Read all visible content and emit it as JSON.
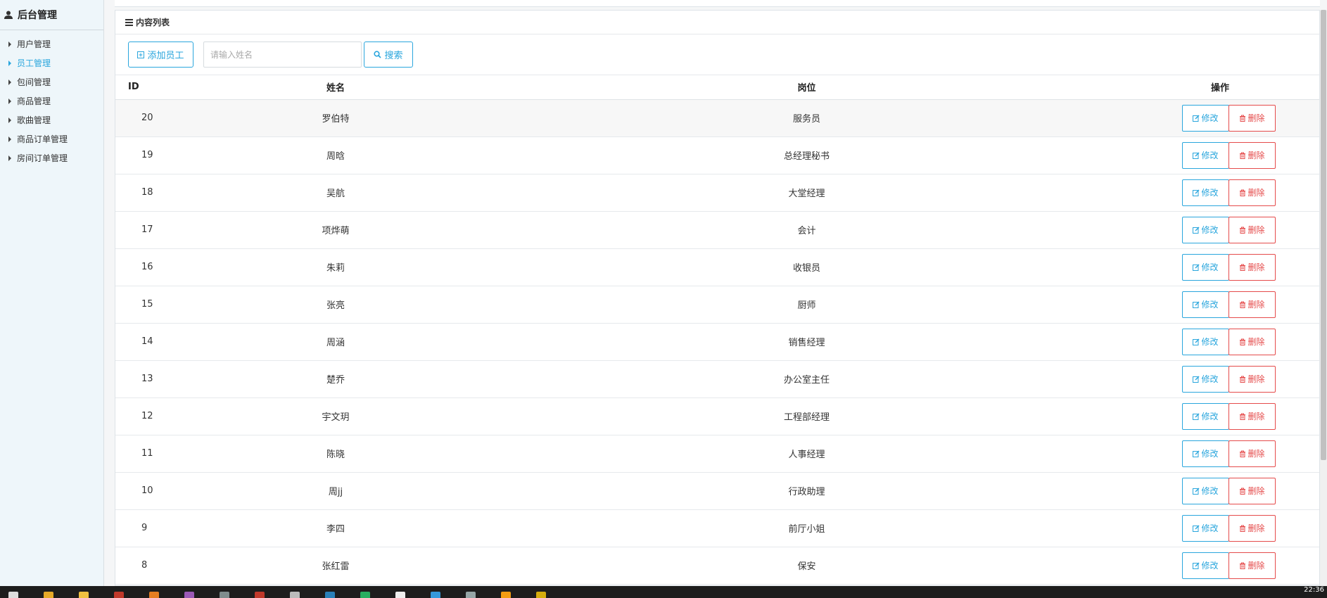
{
  "sidebar": {
    "title": "后台管理",
    "items": [
      {
        "label": "用户管理",
        "active": false
      },
      {
        "label": "员工管理",
        "active": true
      },
      {
        "label": "包间管理",
        "active": false
      },
      {
        "label": "商品管理",
        "active": false
      },
      {
        "label": "歌曲管理",
        "active": false
      },
      {
        "label": "商品订单管理",
        "active": false
      },
      {
        "label": "房间订单管理",
        "active": false
      }
    ]
  },
  "panel": {
    "title": "内容列表"
  },
  "toolbar": {
    "add_label": "添加员工",
    "search_placeholder": "请输入姓名",
    "search_label": "搜索"
  },
  "table": {
    "headers": {
      "id": "ID",
      "name": "姓名",
      "position": "岗位",
      "actions": "操作"
    },
    "edit_label": "修改",
    "delete_label": "删除",
    "rows": [
      {
        "id": "20",
        "name": "罗伯特",
        "position": "服务员"
      },
      {
        "id": "19",
        "name": "周晗",
        "position": "总经理秘书"
      },
      {
        "id": "18",
        "name": "吴航",
        "position": "大堂经理"
      },
      {
        "id": "17",
        "name": "项烨萌",
        "position": "会计"
      },
      {
        "id": "16",
        "name": "朱莉",
        "position": "收银员"
      },
      {
        "id": "15",
        "name": "张亮",
        "position": "厨师"
      },
      {
        "id": "14",
        "name": "周涵",
        "position": "销售经理"
      },
      {
        "id": "13",
        "name": "楚乔",
        "position": "办公室主任"
      },
      {
        "id": "12",
        "name": "宇文玥",
        "position": "工程部经理"
      },
      {
        "id": "11",
        "name": "陈晓",
        "position": "人事经理"
      },
      {
        "id": "10",
        "name": "周jj",
        "position": "行政助理"
      },
      {
        "id": "9",
        "name": "李四",
        "position": "前厅小姐"
      },
      {
        "id": "8",
        "name": "张红雷",
        "position": "保安"
      }
    ]
  },
  "taskbar": {
    "clock": "22:36"
  },
  "colors": {
    "accent": "#2aa6dd",
    "danger": "#e54b4b"
  }
}
